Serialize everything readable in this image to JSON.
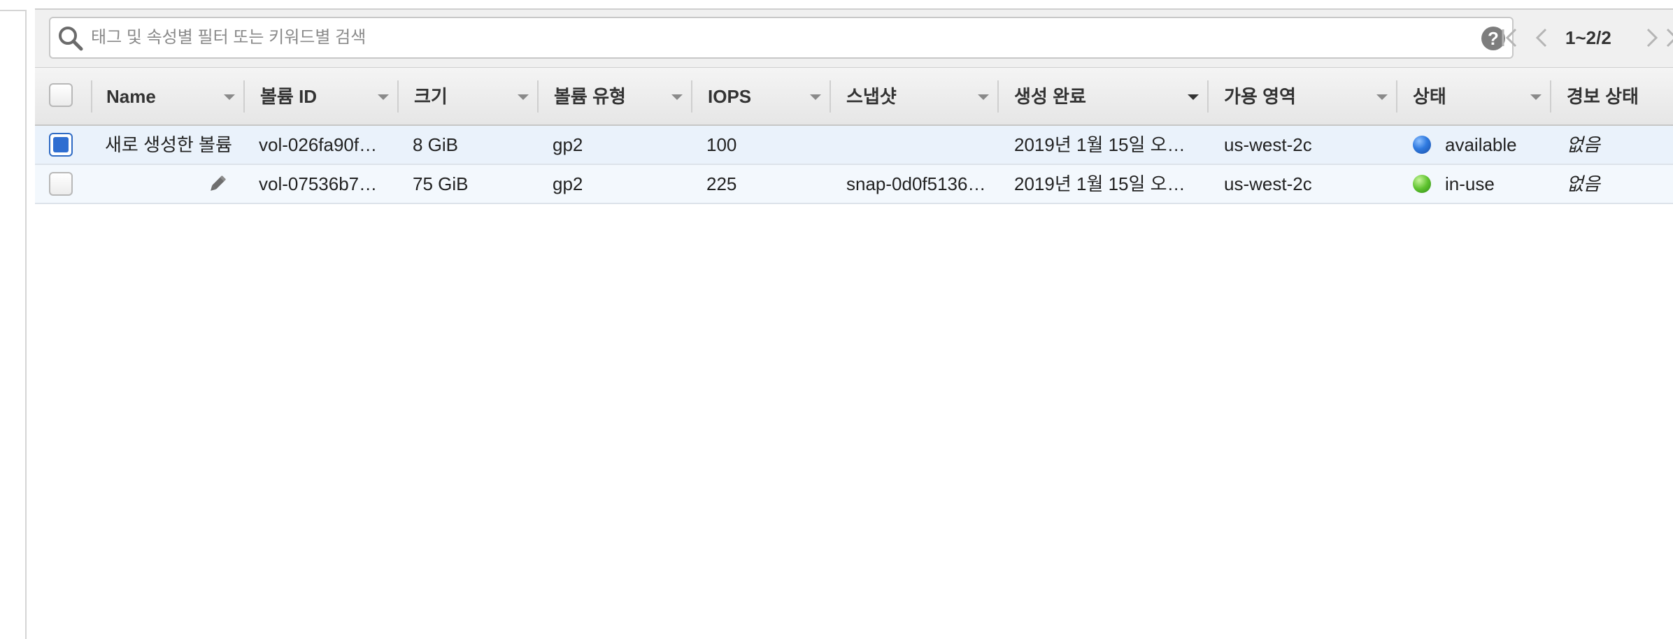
{
  "search": {
    "placeholder": "태그 및 속성별 필터 또는 키워드별 검색",
    "value": ""
  },
  "pager": {
    "label": "1~2/2"
  },
  "table": {
    "columns": [
      {
        "label": "Name"
      },
      {
        "label": "볼륨 ID"
      },
      {
        "label": "크기"
      },
      {
        "label": "볼륨 유형"
      },
      {
        "label": "IOPS"
      },
      {
        "label": "스냅샷"
      },
      {
        "label": "생성 완료"
      },
      {
        "label": "가용 영역"
      },
      {
        "label": "상태"
      },
      {
        "label": "경보 상태"
      }
    ],
    "rows": [
      {
        "selected": true,
        "name": "새로 생성한 볼륨",
        "volume_id": "vol-026fa90f…",
        "size": "8 GiB",
        "type": "gp2",
        "iops": "100",
        "snapshot": "",
        "created": "2019년 1월 15일 오…",
        "zone": "us-west-2c",
        "state": "available",
        "state_color": "#2f7ae0",
        "alarm": "없음"
      },
      {
        "selected": false,
        "name": "",
        "volume_id": "vol-07536b7…",
        "size": "75 GiB",
        "type": "gp2",
        "iops": "225",
        "snapshot": "snap-0d0f5136…",
        "created": "2019년 1월 15일 오…",
        "zone": "us-west-2c",
        "state": "in-use",
        "state_color": "#5fc32f",
        "alarm": "없음"
      }
    ]
  },
  "icons": {
    "search": "search-icon",
    "help": "help-icon",
    "first": "first-page-icon",
    "prev": "previous-page-icon",
    "next": "next-page-icon",
    "last": "last-page-icon",
    "edit": "pencil-icon"
  }
}
